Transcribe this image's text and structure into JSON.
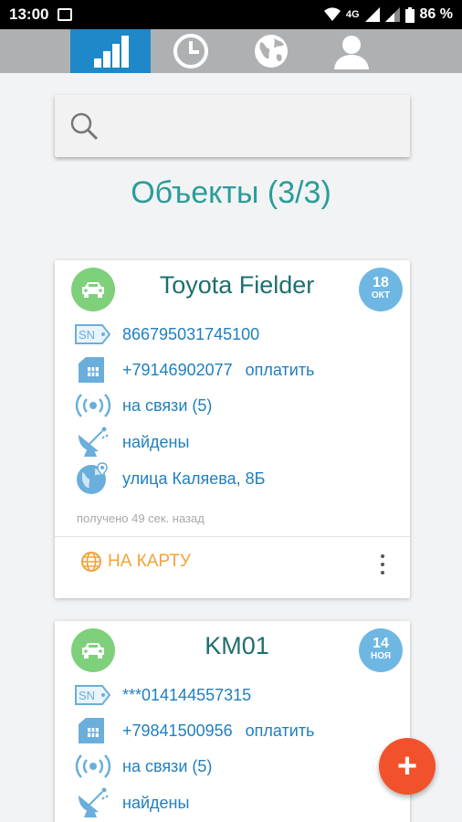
{
  "status_bar": {
    "time": "13:00",
    "network": "4G",
    "battery": "86 %"
  },
  "tabs": [
    {
      "name": "objects",
      "icon": "bar-chart-icon",
      "active": true
    },
    {
      "name": "history",
      "icon": "clock-icon",
      "active": false
    },
    {
      "name": "map",
      "icon": "globe-icon",
      "active": false
    },
    {
      "name": "profile",
      "icon": "user-icon",
      "active": false
    }
  ],
  "search": {
    "placeholder": ""
  },
  "page_title": "Объекты (3/3)",
  "objects": [
    {
      "name": "Toyota Fielder",
      "date_day": "18",
      "date_month": "ОКТ",
      "serial": "866795031745100",
      "phone": "+79146902077",
      "pay_label": "оплатить",
      "connection": "на связи (5)",
      "gps": "найдены",
      "address": "улица Каляева, 8Б",
      "received": "получено 49 сек. назад",
      "map_label": "НА КАРТУ"
    },
    {
      "name": "KM01",
      "date_day": "14",
      "date_month": "НОЯ",
      "serial": "***014144557315",
      "phone": "+79841500956",
      "pay_label": "оплатить",
      "connection": "на связи (5)",
      "gps": "найдены"
    }
  ],
  "fab": {
    "label": "+"
  },
  "colors": {
    "accent": "#1e88c8",
    "title": "#2a9d9a",
    "link": "#1f7fc0",
    "map": "#f1a33a",
    "fab": "#f2522b",
    "car": "#7ed07b"
  }
}
